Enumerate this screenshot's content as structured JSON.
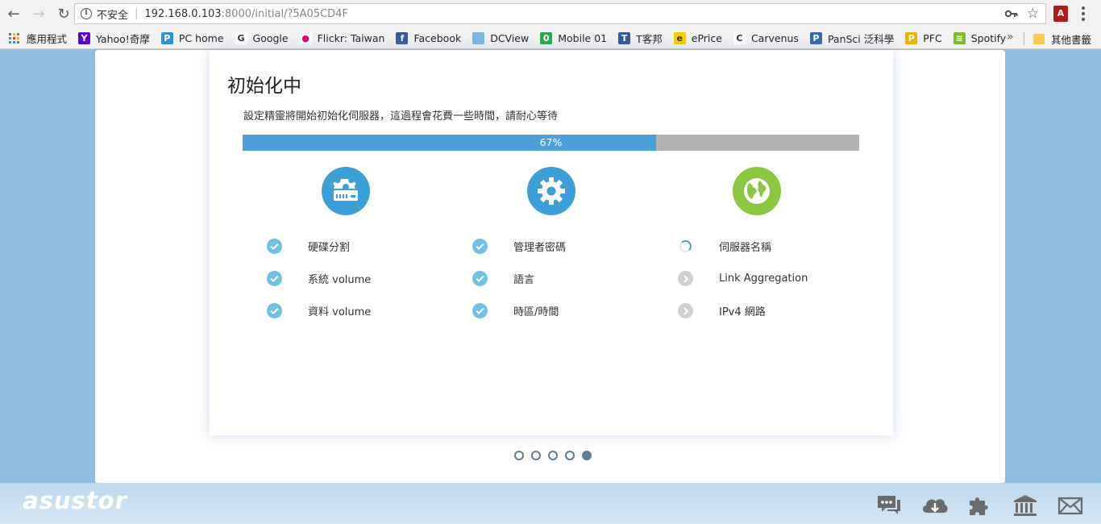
{
  "browser": {
    "insecure_label": "不安全",
    "url_host": "192.168.0.103",
    "url_rest": ":8000/initial/?5A05CD4F",
    "bookmarks": [
      {
        "label": "應用程式",
        "icon": "apps-icon"
      },
      {
        "label": "Yahoo!奇摩",
        "icon": "yahoo-icon"
      },
      {
        "label": "PC home",
        "icon": "pchome-icon"
      },
      {
        "label": "Google",
        "icon": "google-icon"
      },
      {
        "label": "Flickr: Taiwan",
        "icon": "flickr-icon"
      },
      {
        "label": "Facebook",
        "icon": "facebook-icon"
      },
      {
        "label": "DCView",
        "icon": "dcview-icon"
      },
      {
        "label": "Mobile 01",
        "icon": "mobile01-icon"
      },
      {
        "label": "T客邦",
        "icon": "tkebang-icon"
      },
      {
        "label": "ePrice",
        "icon": "eprice-icon"
      },
      {
        "label": "Carvenus",
        "icon": "carvenus-icon"
      },
      {
        "label": "PanSci 泛科學",
        "icon": "pansci-icon"
      },
      {
        "label": "PFC",
        "icon": "pfc-icon"
      },
      {
        "label": "Spotify",
        "icon": "spotify-icon"
      }
    ],
    "more_label": "»",
    "other_bookmarks": "其他書籤"
  },
  "wizard": {
    "title": "初始化中",
    "subtitle": "設定精靈將開始初始化伺服器，這過程會花費一些時間，請耐心等待",
    "progress_label": "67%",
    "progress_value": 0.67,
    "columns": [
      {
        "icon": "storage-gear-icon",
        "color": "#3b9fd8",
        "tasks": [
          {
            "label": "硬碟分割",
            "status": "done"
          },
          {
            "label": "系統 volume",
            "status": "done"
          },
          {
            "label": "資料 volume",
            "status": "done"
          }
        ]
      },
      {
        "icon": "gear-icon",
        "color": "#3b9fd8",
        "tasks": [
          {
            "label": "管理者密碼",
            "status": "done"
          },
          {
            "label": "語言",
            "status": "done"
          },
          {
            "label": "時區/時間",
            "status": "done"
          }
        ]
      },
      {
        "icon": "globe-icon",
        "color": "#8cc63f",
        "tasks": [
          {
            "label": "伺服器名稱",
            "status": "loading"
          },
          {
            "label": "Link Aggregation",
            "status": "pending"
          },
          {
            "label": "IPv4 網路",
            "status": "pending"
          }
        ]
      }
    ],
    "steps_total": 5,
    "steps_active": 5
  },
  "footer": {
    "brand": "asustor",
    "icons": [
      "chat-icon",
      "cloud-download-icon",
      "puzzle-icon",
      "bank-icon",
      "mail-icon"
    ]
  }
}
